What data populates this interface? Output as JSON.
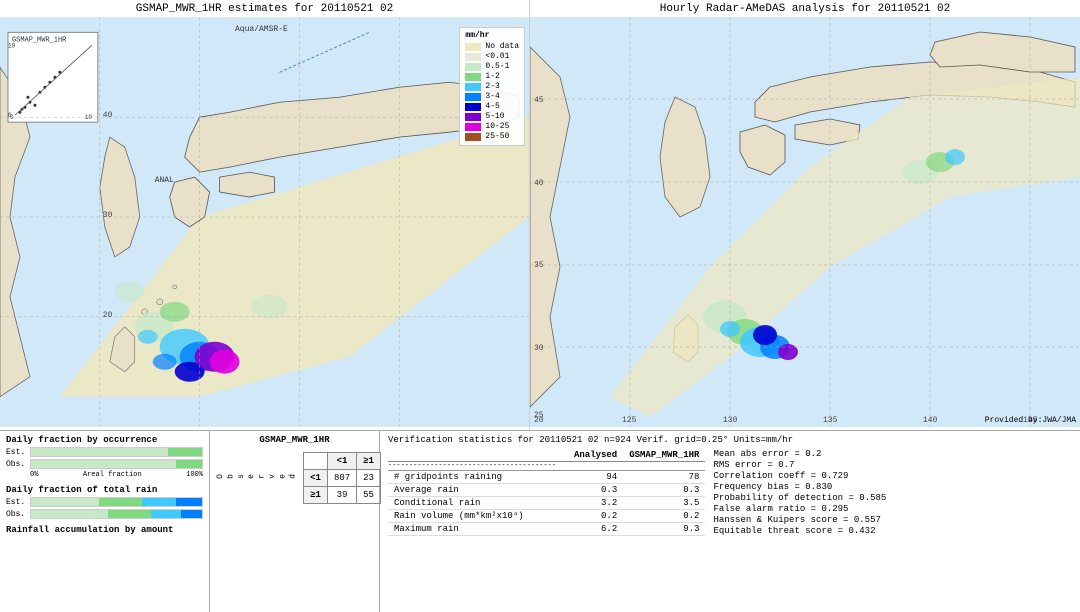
{
  "left_panel": {
    "title": "GSMAP_MWR_1HR estimates for 20110521 02"
  },
  "right_panel": {
    "title": "Hourly Radar-AMeDAS analysis for 20110521 02",
    "provided_by": "Provided by:JWA/JMA"
  },
  "legend": {
    "title": "mm/hr",
    "items": [
      {
        "label": "No data",
        "color": "#f5f0d0"
      },
      {
        "label": "<0.01",
        "color": "#f0ece0"
      },
      {
        "label": "0.5-1",
        "color": "#c8e8c8"
      },
      {
        "label": "1-2",
        "color": "#80d880"
      },
      {
        "label": "2-3",
        "color": "#40c8ff"
      },
      {
        "label": "3-4",
        "color": "#0080ff"
      },
      {
        "label": "4-5",
        "color": "#0000d0"
      },
      {
        "label": "5-10",
        "color": "#8000d0"
      },
      {
        "label": "10-25",
        "color": "#e000e0"
      },
      {
        "label": "25-50",
        "color": "#a05020"
      }
    ]
  },
  "bar_charts": {
    "occurrence_title": "Daily fraction by occurrence",
    "total_rain_title": "Daily fraction of total rain",
    "accumulation_title": "Rainfall accumulation by amount",
    "est_label": "Est.",
    "obs_label": "Obs.",
    "axis_left": "0%",
    "axis_right": "100%",
    "axis_mid": "Areal fraction"
  },
  "contingency": {
    "title": "GSMAP_MWR_1HR",
    "col_header1": "<1",
    "col_header2": "≥1",
    "row_header1": "<1",
    "row_header2": "≥1",
    "observed_label": "O\nb\ns\ne\nr\nv\ne\nd",
    "cell_11": "807",
    "cell_12": "23",
    "cell_21": "39",
    "cell_22": "55"
  },
  "verification": {
    "header": "Verification statistics for 20110521 02  n=924  Verif. grid=0.25°  Units=mm/hr",
    "col_analysed": "Analysed",
    "col_gsmap": "GSMAP_MWR_1HR",
    "divider": "-------------------------------------------",
    "rows": [
      {
        "label": "# gridpoints raining",
        "analysed": "94",
        "gsmap": "78"
      },
      {
        "label": "Average rain",
        "analysed": "0.3",
        "gsmap": "0.3"
      },
      {
        "label": "Conditional rain",
        "analysed": "3.2",
        "gsmap": "3.5"
      },
      {
        "label": "Rain volume (mm*km²x10⁴)",
        "analysed": "0.2",
        "gsmap": "0.2"
      },
      {
        "label": "Maximum rain",
        "analysed": "6.2",
        "gsmap": "9.3"
      }
    ],
    "stats": [
      "Mean abs error = 0.2",
      "RMS error = 0.7",
      "Correlation coeff = 0.729",
      "Frequency bias = 0.830",
      "Probability of detection = 0.585",
      "False alarm ratio = 0.295",
      "Hanssen & Kuipers score = 0.557",
      "Equitable threat score = 0.432"
    ]
  },
  "inset": {
    "label": "GSMAP_MWR_1HR"
  },
  "aqua_label": "Aqua/AMSR-E",
  "anal_label": "ANAL"
}
